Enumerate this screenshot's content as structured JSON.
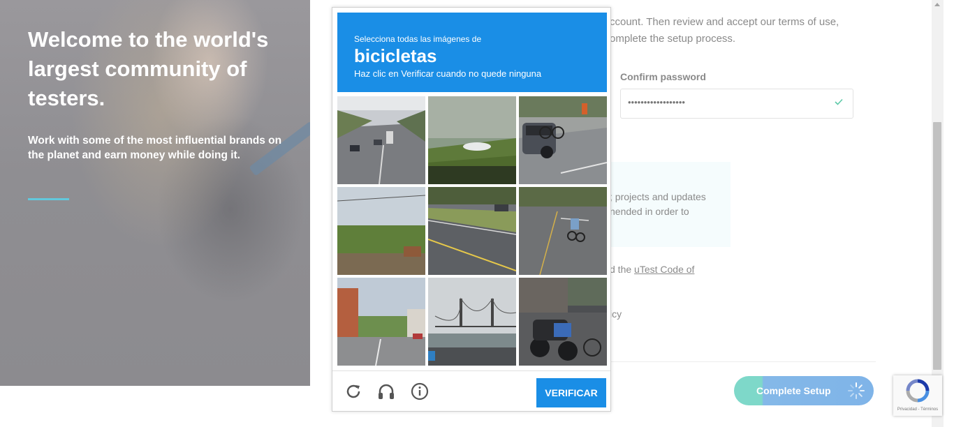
{
  "hero": {
    "title": "Welcome to the world's largest community of testers.",
    "subtitle": "Work with some of the most influential brands on the planet and earn money while doing it."
  },
  "form": {
    "intro": "ccount. Then review and accept our terms of use, omplete the setup process.",
    "confirm_label": "Confirm password",
    "confirm_value": "••••••••••••••••••",
    "info_text": "; projects and updates nended in order to",
    "agree_text": "d the ",
    "agree_link": "uTest Code of",
    "privacy_fragment": "icy",
    "complete_button": "Complete Setup"
  },
  "captcha": {
    "instruction_pre": "Selecciona todas las imágenes de",
    "target": "bicicletas",
    "instruction_post": "Haz clic en Verificar cuando no quede ninguna",
    "verify_label": "VERIFICAR",
    "tiles": [
      "highway-tile",
      "water-tile",
      "car-bike-tile",
      "trees-tile",
      "road-tile",
      "cyclist-tile",
      "street-tile",
      "bridge-tile",
      "motorcycles-tile"
    ]
  },
  "recaptcha_badge": {
    "terms": "Privacidad - Términos"
  },
  "colors": {
    "accent": "#1a8ee6",
    "teal": "#62c8dc"
  }
}
